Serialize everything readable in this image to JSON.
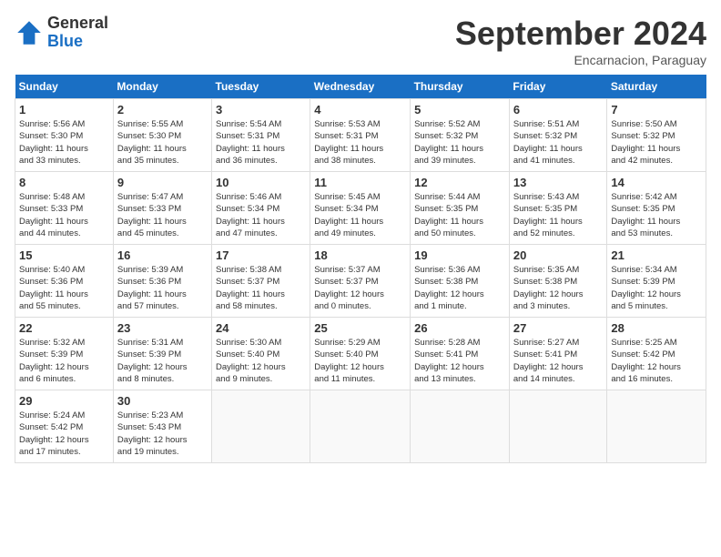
{
  "header": {
    "logo_general": "General",
    "logo_blue": "Blue",
    "month_title": "September 2024",
    "location": "Encarnacion, Paraguay"
  },
  "columns": [
    "Sunday",
    "Monday",
    "Tuesday",
    "Wednesday",
    "Thursday",
    "Friday",
    "Saturday"
  ],
  "weeks": [
    [
      {
        "day": "1",
        "lines": [
          "Sunrise: 5:56 AM",
          "Sunset: 5:30 PM",
          "Daylight: 11 hours",
          "and 33 minutes."
        ]
      },
      {
        "day": "2",
        "lines": [
          "Sunrise: 5:55 AM",
          "Sunset: 5:30 PM",
          "Daylight: 11 hours",
          "and 35 minutes."
        ]
      },
      {
        "day": "3",
        "lines": [
          "Sunrise: 5:54 AM",
          "Sunset: 5:31 PM",
          "Daylight: 11 hours",
          "and 36 minutes."
        ]
      },
      {
        "day": "4",
        "lines": [
          "Sunrise: 5:53 AM",
          "Sunset: 5:31 PM",
          "Daylight: 11 hours",
          "and 38 minutes."
        ]
      },
      {
        "day": "5",
        "lines": [
          "Sunrise: 5:52 AM",
          "Sunset: 5:32 PM",
          "Daylight: 11 hours",
          "and 39 minutes."
        ]
      },
      {
        "day": "6",
        "lines": [
          "Sunrise: 5:51 AM",
          "Sunset: 5:32 PM",
          "Daylight: 11 hours",
          "and 41 minutes."
        ]
      },
      {
        "day": "7",
        "lines": [
          "Sunrise: 5:50 AM",
          "Sunset: 5:32 PM",
          "Daylight: 11 hours",
          "and 42 minutes."
        ]
      }
    ],
    [
      {
        "day": "8",
        "lines": [
          "Sunrise: 5:48 AM",
          "Sunset: 5:33 PM",
          "Daylight: 11 hours",
          "and 44 minutes."
        ]
      },
      {
        "day": "9",
        "lines": [
          "Sunrise: 5:47 AM",
          "Sunset: 5:33 PM",
          "Daylight: 11 hours",
          "and 45 minutes."
        ]
      },
      {
        "day": "10",
        "lines": [
          "Sunrise: 5:46 AM",
          "Sunset: 5:34 PM",
          "Daylight: 11 hours",
          "and 47 minutes."
        ]
      },
      {
        "day": "11",
        "lines": [
          "Sunrise: 5:45 AM",
          "Sunset: 5:34 PM",
          "Daylight: 11 hours",
          "and 49 minutes."
        ]
      },
      {
        "day": "12",
        "lines": [
          "Sunrise: 5:44 AM",
          "Sunset: 5:35 PM",
          "Daylight: 11 hours",
          "and 50 minutes."
        ]
      },
      {
        "day": "13",
        "lines": [
          "Sunrise: 5:43 AM",
          "Sunset: 5:35 PM",
          "Daylight: 11 hours",
          "and 52 minutes."
        ]
      },
      {
        "day": "14",
        "lines": [
          "Sunrise: 5:42 AM",
          "Sunset: 5:35 PM",
          "Daylight: 11 hours",
          "and 53 minutes."
        ]
      }
    ],
    [
      {
        "day": "15",
        "lines": [
          "Sunrise: 5:40 AM",
          "Sunset: 5:36 PM",
          "Daylight: 11 hours",
          "and 55 minutes."
        ]
      },
      {
        "day": "16",
        "lines": [
          "Sunrise: 5:39 AM",
          "Sunset: 5:36 PM",
          "Daylight: 11 hours",
          "and 57 minutes."
        ]
      },
      {
        "day": "17",
        "lines": [
          "Sunrise: 5:38 AM",
          "Sunset: 5:37 PM",
          "Daylight: 11 hours",
          "and 58 minutes."
        ]
      },
      {
        "day": "18",
        "lines": [
          "Sunrise: 5:37 AM",
          "Sunset: 5:37 PM",
          "Daylight: 12 hours",
          "and 0 minutes."
        ]
      },
      {
        "day": "19",
        "lines": [
          "Sunrise: 5:36 AM",
          "Sunset: 5:38 PM",
          "Daylight: 12 hours",
          "and 1 minute."
        ]
      },
      {
        "day": "20",
        "lines": [
          "Sunrise: 5:35 AM",
          "Sunset: 5:38 PM",
          "Daylight: 12 hours",
          "and 3 minutes."
        ]
      },
      {
        "day": "21",
        "lines": [
          "Sunrise: 5:34 AM",
          "Sunset: 5:39 PM",
          "Daylight: 12 hours",
          "and 5 minutes."
        ]
      }
    ],
    [
      {
        "day": "22",
        "lines": [
          "Sunrise: 5:32 AM",
          "Sunset: 5:39 PM",
          "Daylight: 12 hours",
          "and 6 minutes."
        ]
      },
      {
        "day": "23",
        "lines": [
          "Sunrise: 5:31 AM",
          "Sunset: 5:39 PM",
          "Daylight: 12 hours",
          "and 8 minutes."
        ]
      },
      {
        "day": "24",
        "lines": [
          "Sunrise: 5:30 AM",
          "Sunset: 5:40 PM",
          "Daylight: 12 hours",
          "and 9 minutes."
        ]
      },
      {
        "day": "25",
        "lines": [
          "Sunrise: 5:29 AM",
          "Sunset: 5:40 PM",
          "Daylight: 12 hours",
          "and 11 minutes."
        ]
      },
      {
        "day": "26",
        "lines": [
          "Sunrise: 5:28 AM",
          "Sunset: 5:41 PM",
          "Daylight: 12 hours",
          "and 13 minutes."
        ]
      },
      {
        "day": "27",
        "lines": [
          "Sunrise: 5:27 AM",
          "Sunset: 5:41 PM",
          "Daylight: 12 hours",
          "and 14 minutes."
        ]
      },
      {
        "day": "28",
        "lines": [
          "Sunrise: 5:25 AM",
          "Sunset: 5:42 PM",
          "Daylight: 12 hours",
          "and 16 minutes."
        ]
      }
    ],
    [
      {
        "day": "29",
        "lines": [
          "Sunrise: 5:24 AM",
          "Sunset: 5:42 PM",
          "Daylight: 12 hours",
          "and 17 minutes."
        ]
      },
      {
        "day": "30",
        "lines": [
          "Sunrise: 5:23 AM",
          "Sunset: 5:43 PM",
          "Daylight: 12 hours",
          "and 19 minutes."
        ]
      },
      {
        "day": "",
        "lines": []
      },
      {
        "day": "",
        "lines": []
      },
      {
        "day": "",
        "lines": []
      },
      {
        "day": "",
        "lines": []
      },
      {
        "day": "",
        "lines": []
      }
    ]
  ]
}
